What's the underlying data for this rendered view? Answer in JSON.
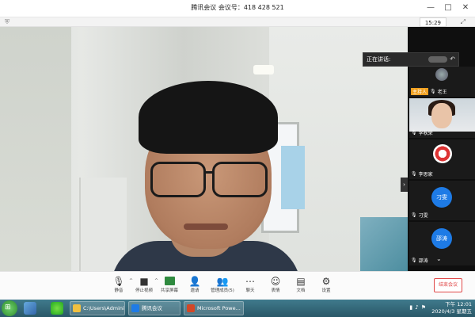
{
  "window": {
    "title": "腾讯会议 会议号：418 428 521",
    "controls": [
      "—",
      "□",
      "✕"
    ]
  },
  "subbar": {
    "clock": "15:29"
  },
  "speaking_popup": {
    "label": "正在讲话:"
  },
  "participants": [
    {
      "name": "老王",
      "badge": "主持人"
    },
    {
      "name": "李秋荣"
    },
    {
      "name": "李思家"
    },
    {
      "name": "刁雯",
      "avatar_text": "刁雯"
    },
    {
      "name": "邵涛",
      "avatar_text": "邵涛"
    }
  ],
  "toolbar": {
    "tools": [
      {
        "name": "mute",
        "label": "静音",
        "icon": "microphone-icon"
      },
      {
        "name": "stop-video",
        "label": "停止视频",
        "icon": "camera-icon"
      },
      {
        "name": "share-screen",
        "label": "共享屏幕",
        "icon": "share-screen-icon"
      },
      {
        "name": "invite",
        "label": "邀请",
        "icon": "invite-icon"
      },
      {
        "name": "manage-members",
        "label": "管理成员(5)",
        "icon": "members-icon"
      },
      {
        "name": "chat",
        "label": "聊天",
        "icon": "chat-icon"
      },
      {
        "name": "emoji",
        "label": "表情",
        "icon": "emoji-icon"
      },
      {
        "name": "docs",
        "label": "文档",
        "icon": "document-icon"
      },
      {
        "name": "settings",
        "label": "设置",
        "icon": "settings-icon"
      }
    ],
    "end_label": "结束会议"
  },
  "taskbar": {
    "tasks": [
      {
        "label": "C:\\Users\\Admini..."
      },
      {
        "label": "腾讯会议"
      },
      {
        "label": "Microsoft Powe..."
      }
    ],
    "time": "下午 12:01",
    "date": "2020/4/3 星期五"
  },
  "colors": {
    "accent_blue": "#1e7be6",
    "end_red": "#e04848",
    "host_orange": "#f0a020",
    "taskbar": "#2a5868"
  }
}
